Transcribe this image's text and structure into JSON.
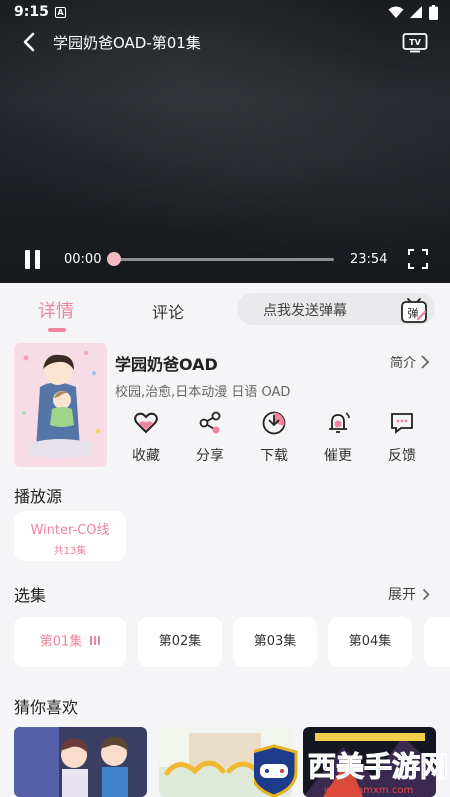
{
  "status_bar": {
    "time": "9:15",
    "badge": "A"
  },
  "player": {
    "title": "学园奶爸OAD-第01集",
    "current_time": "00:00",
    "total_time": "23:54",
    "progress": 0
  },
  "tabs": {
    "details": "详情",
    "comments": "评论"
  },
  "danmu": {
    "placeholder": "点我发送弹幕",
    "icon_char": "弹"
  },
  "anime": {
    "title": "学园奶爸OAD",
    "intro_label": "简介",
    "tags": "校园,治愈,日本动漫 日语 OAD"
  },
  "actions": [
    {
      "label": "收藏",
      "icon": "heart-icon"
    },
    {
      "label": "分享",
      "icon": "share-icon"
    },
    {
      "label": "下载",
      "icon": "download-icon"
    },
    {
      "label": "催更",
      "icon": "bell-icon"
    },
    {
      "label": "反馈",
      "icon": "feedback-icon"
    }
  ],
  "sources": {
    "heading": "播放源",
    "items": [
      {
        "name": "Winter-CO线",
        "count": "共13集"
      }
    ]
  },
  "episodes": {
    "heading": "选集",
    "expand_label": "展开",
    "items": [
      "第01集",
      "第02集",
      "第03集",
      "第04集"
    ],
    "active_index": 0
  },
  "recommend": {
    "heading": "猜你喜欢"
  },
  "colors": {
    "accent": "#f0839d",
    "background": "#f5f5f7"
  }
}
